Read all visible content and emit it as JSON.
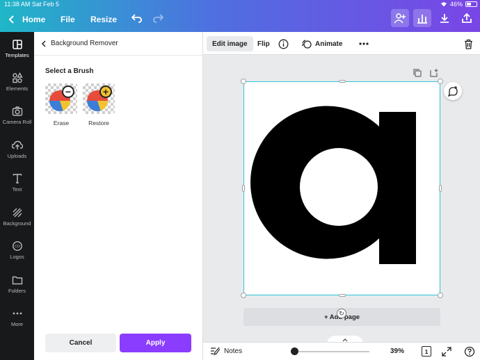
{
  "status_bar": {
    "time": "11:38 AM",
    "date": "Sat Feb 5",
    "battery": "46%"
  },
  "toolbar": {
    "home_label": "Home",
    "file_label": "File",
    "resize_label": "Resize"
  },
  "rail": {
    "items": [
      {
        "label": "Templates",
        "icon": "templates-icon"
      },
      {
        "label": "Elements",
        "icon": "elements-icon"
      },
      {
        "label": "Camera Roll",
        "icon": "camera-icon"
      },
      {
        "label": "Uploads",
        "icon": "upload-icon"
      },
      {
        "label": "Text",
        "icon": "text-icon"
      },
      {
        "label": "Background",
        "icon": "background-icon"
      },
      {
        "label": "Logos",
        "icon": "logos-icon"
      },
      {
        "label": "Folders",
        "icon": "folder-icon"
      },
      {
        "label": "More",
        "icon": "more-icon"
      }
    ]
  },
  "panel": {
    "title": "Background Remover",
    "subtitle": "Select a Brush",
    "brushes": [
      {
        "label": "Erase",
        "badge": "−"
      },
      {
        "label": "Restore",
        "badge": "+"
      }
    ],
    "cancel_label": "Cancel",
    "apply_label": "Apply"
  },
  "edit_bar": {
    "edit_image_label": "Edit image",
    "flip_label": "Flip",
    "animate_label": "Animate"
  },
  "canvas": {
    "add_page_label": "+ Add page"
  },
  "bottom_bar": {
    "notes_label": "Notes",
    "zoom": "39%",
    "page_count": "1",
    "zoom_fraction": 0.04
  },
  "colors": {
    "accent": "#8b3dff",
    "selection": "#2ec4d6",
    "rail_bg": "#18191b"
  }
}
